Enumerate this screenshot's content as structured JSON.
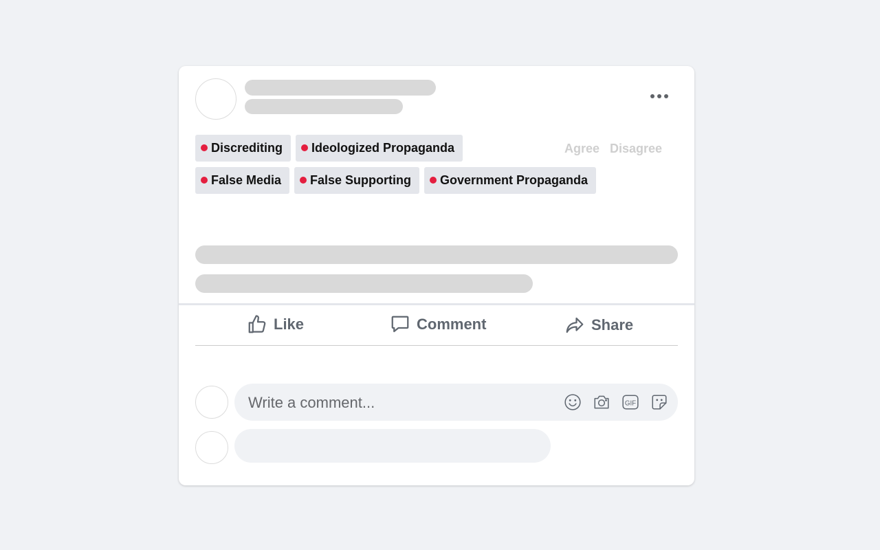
{
  "post": {
    "more_menu_icon": "more-horizontal-icon",
    "tags": [
      {
        "label": "Discrediting"
      },
      {
        "label": "Ideologized Propaganda"
      },
      {
        "label": "False Media"
      },
      {
        "label": "False Supporting"
      },
      {
        "label": "Government Propaganda"
      }
    ],
    "tag_dot_color": "#e41e3f",
    "vote": {
      "agree": "Agree",
      "disagree": "Disagree"
    }
  },
  "actions": {
    "like": {
      "label": "Like",
      "icon": "thumbs-up-icon"
    },
    "comment": {
      "label": "Comment",
      "icon": "speech-bubble-icon"
    },
    "share": {
      "label": "Share",
      "icon": "share-arrow-icon"
    }
  },
  "comment_input": {
    "placeholder": "Write a comment...",
    "icons": [
      "smiley-icon",
      "camera-icon",
      "gif-icon",
      "sticker-icon"
    ]
  }
}
